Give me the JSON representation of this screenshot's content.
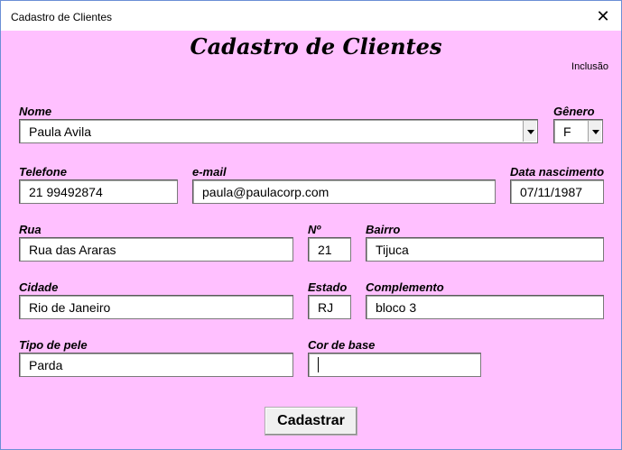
{
  "window": {
    "title": "Cadastro de Clientes",
    "close_glyph": "✕"
  },
  "form": {
    "heading": "Cadastro de Clientes",
    "mode": "Inclusão",
    "fields": {
      "nome": {
        "label": "Nome",
        "value": "Paula Avila"
      },
      "genero": {
        "label": "Gênero",
        "value": "F"
      },
      "telefone": {
        "label": "Telefone",
        "value": "21 99492874"
      },
      "email": {
        "label": "e-mail",
        "value": "paula@paulacorp.com"
      },
      "nascimento": {
        "label": "Data nascimento",
        "value": "07/11/1987"
      },
      "rua": {
        "label": "Rua",
        "value": "Rua das Araras"
      },
      "numero": {
        "label": "Nº",
        "value": "21"
      },
      "bairro": {
        "label": "Bairro",
        "value": "Tijuca"
      },
      "cidade": {
        "label": "Cidade",
        "value": "Rio de Janeiro"
      },
      "estado": {
        "label": "Estado",
        "value": "RJ"
      },
      "complemento": {
        "label": "Complemento",
        "value": "bloco 3"
      },
      "pele": {
        "label": "Tipo de pele",
        "value": "Parda"
      },
      "base": {
        "label": "Cor de base",
        "value": ""
      }
    },
    "submit_label": "Cadastrar"
  },
  "colors": {
    "form_background": "#ffc0ff",
    "titlebar": "#ffffff",
    "border": "#6b8fd6"
  }
}
